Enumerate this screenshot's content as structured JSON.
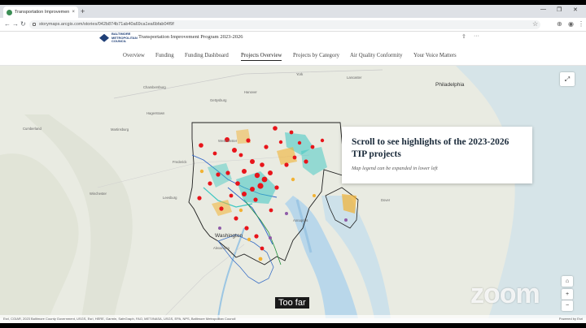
{
  "browser": {
    "tab_title": "Transportation Improvement Pr...",
    "tab_close": "×",
    "new_tab": "+",
    "url": "storymaps.arcgis.com/stories/042b874b71ab40a69ca1ea6bfab04f9f",
    "minimize": "—",
    "maximize": "❐",
    "close": "✕"
  },
  "site": {
    "logo_lines": [
      "BALTIMORE",
      "METROPOLITAN",
      "COUNCIL"
    ],
    "title": "Transportation Improvement Program 2023-2026"
  },
  "nav": {
    "items": [
      {
        "label": "Overview"
      },
      {
        "label": "Funding"
      },
      {
        "label": "Funding Dashboard"
      },
      {
        "label": "Projects Overview",
        "active": true
      },
      {
        "label": "Projects by Category"
      },
      {
        "label": "Air Quality Conformity"
      },
      {
        "label": "Your Voice Matters"
      }
    ]
  },
  "card": {
    "heading": "Scroll to see highlights of the 2023-2026 TIP projects",
    "subheading": "Map legend can be expanded in lower left"
  },
  "map": {
    "places": [
      "Philadelphia",
      "Washington",
      "Frederick",
      "Hagerstown",
      "Chambersburg",
      "Gettysburg",
      "Hanover",
      "York",
      "Lancaster",
      "Westminster",
      "Martinsburg",
      "Winchester",
      "Leesburg",
      "Dover",
      "Alexandria",
      "Annapolis",
      "Cumberland"
    ],
    "attribution": "Esri, CGIAR, 2023 Baltimore County Government, USGS, Esri, HERE, Garmin, SafeGraph, FAO, METI/NASA, USGS, EPA, NPS, Baltimore Metropolitan Council",
    "powered": "Powered by Esri"
  },
  "overlay": {
    "caption": "Too far",
    "watermark": "zoom"
  },
  "colors": {
    "project_red": "#e8141a",
    "project_orange": "#f2b233",
    "project_teal": "#3ec7c2",
    "project_purple": "#8f5ca8",
    "boundary": "#1f1f1f"
  }
}
